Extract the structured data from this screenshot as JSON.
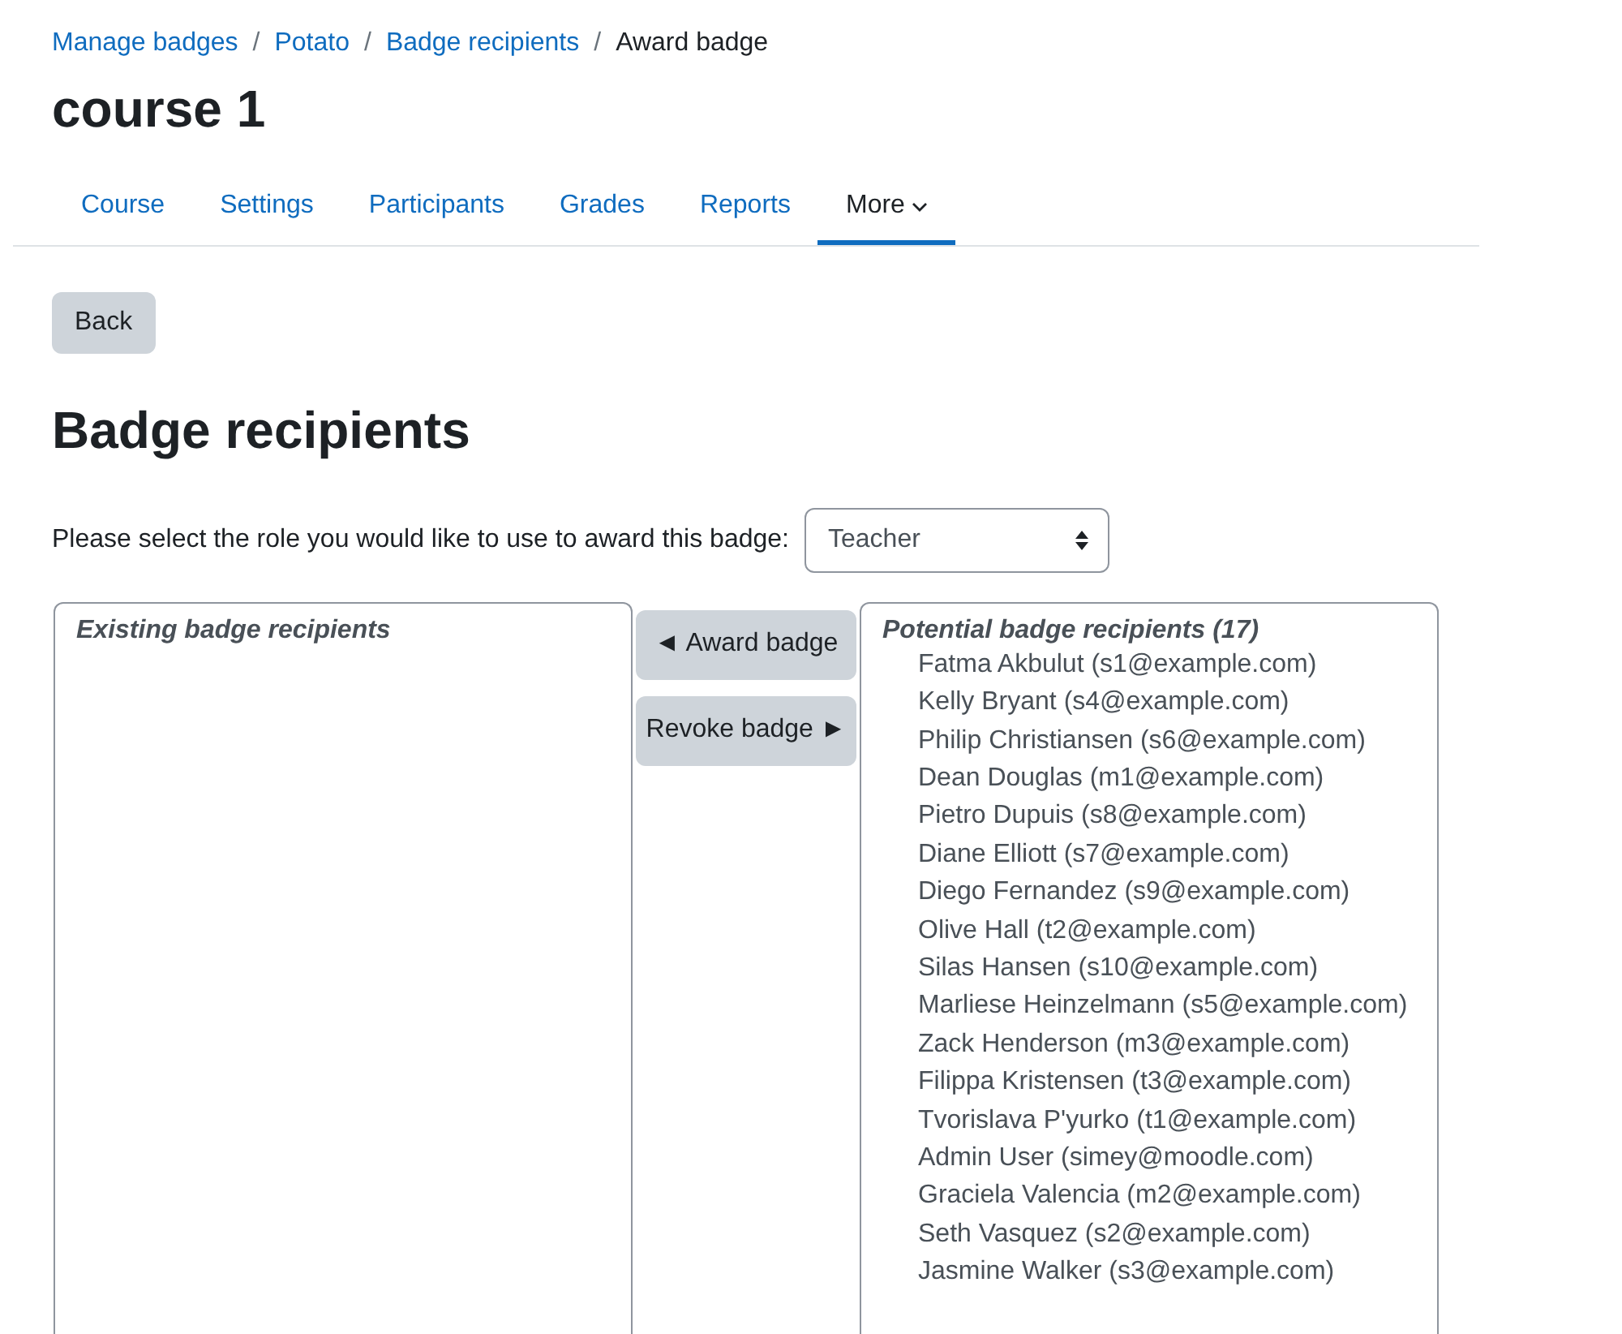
{
  "breadcrumb": [
    {
      "label": "Manage badges",
      "link": true
    },
    {
      "label": "Potato",
      "link": true
    },
    {
      "label": "Badge recipients",
      "link": true
    },
    {
      "label": "Award badge",
      "link": false
    }
  ],
  "separator": "/",
  "course_title": "course 1",
  "tabs": [
    {
      "label": "Course",
      "selected": false,
      "dropdown": false
    },
    {
      "label": "Settings",
      "selected": false,
      "dropdown": false
    },
    {
      "label": "Participants",
      "selected": false,
      "dropdown": false
    },
    {
      "label": "Grades",
      "selected": false,
      "dropdown": false
    },
    {
      "label": "Reports",
      "selected": false,
      "dropdown": false
    },
    {
      "label": "More",
      "selected": true,
      "dropdown": true
    }
  ],
  "back_button": "Back",
  "heading": "Badge recipients",
  "role_prompt": "Please select the role you would like to use to award this badge:",
  "role_select": {
    "value": "Teacher"
  },
  "existing": {
    "title": "Existing badge recipients"
  },
  "actions": [
    "◄ Award badge",
    "Revoke badge ►"
  ],
  "potential": {
    "title": "Potential badge recipients (17)",
    "items": [
      "Fatma Akbulut (s1@example.com)",
      "Kelly Bryant (s4@example.com)",
      "Philip Christiansen (s6@example.com)",
      "Dean Douglas (m1@example.com)",
      "Pietro Dupuis (s8@example.com)",
      "Diane Elliott (s7@example.com)",
      "Diego Fernandez (s9@example.com)",
      "Olive Hall (t2@example.com)",
      "Silas Hansen (s10@example.com)",
      "Marliese Heinzelmann (s5@example.com)",
      "Zack Henderson (m3@example.com)",
      "Filippa Kristensen (t3@example.com)",
      "Tvorislava P'yurko (t1@example.com)",
      "Admin User (simey@moodle.com)",
      "Graciela Valencia (m2@example.com)",
      "Seth Vasquez (s2@example.com)",
      "Jasmine Walker (s3@example.com)"
    ]
  }
}
